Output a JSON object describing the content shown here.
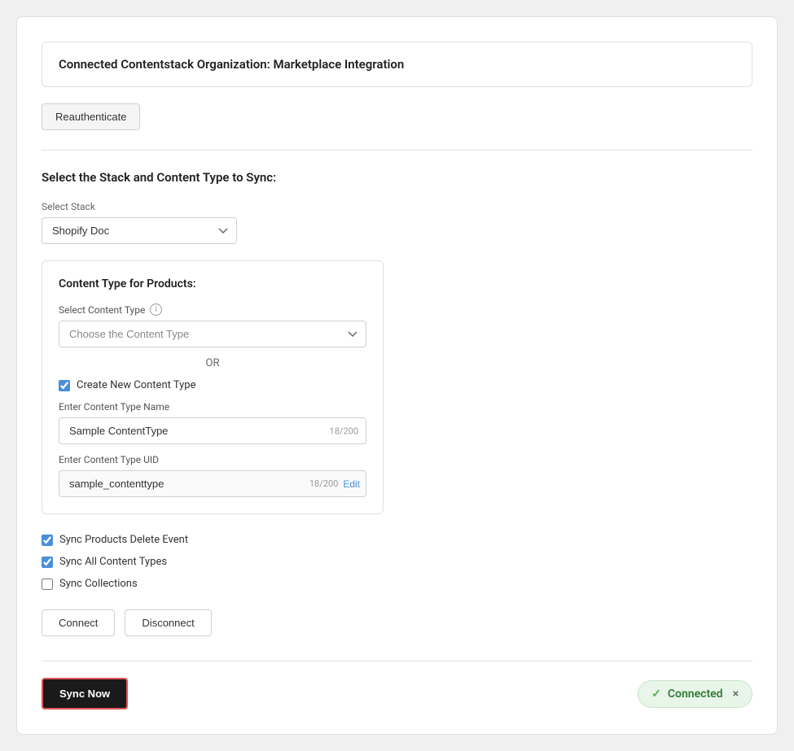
{
  "header": {
    "org_banner": "Connected Contentstack Organization: Marketplace Integration"
  },
  "toolbar": {
    "reauth_label": "Reauthenticate"
  },
  "stack_section": {
    "title": "Select the Stack and Content Type to Sync:",
    "stack_label": "Select Stack",
    "stack_value": "Shopify Doc",
    "stack_placeholder": "Shopify Doc"
  },
  "content_type_card": {
    "title": "Content Type for Products:",
    "select_label": "Select Content Type",
    "select_placeholder": "Choose the Content Type",
    "or_label": "OR",
    "create_new_label": "Create New Content Type",
    "create_new_checked": true,
    "name_label": "Enter Content Type Name",
    "name_value": "Sample ContentType",
    "name_counter": "18/200",
    "uid_label": "Enter Content Type UID",
    "uid_value": "sample_contenttype",
    "uid_counter": "18/200",
    "edit_label": "Edit"
  },
  "sync_options": {
    "sync_delete_label": "Sync Products Delete Event",
    "sync_delete_checked": true,
    "sync_all_label": "Sync All Content Types",
    "sync_all_checked": true,
    "sync_collections_label": "Sync Collections",
    "sync_collections_checked": false
  },
  "action_buttons": {
    "connect_label": "Connect",
    "disconnect_label": "Disconnect"
  },
  "bottom": {
    "sync_now_label": "Sync Now",
    "connected_label": "Connected",
    "close_icon": "×"
  }
}
